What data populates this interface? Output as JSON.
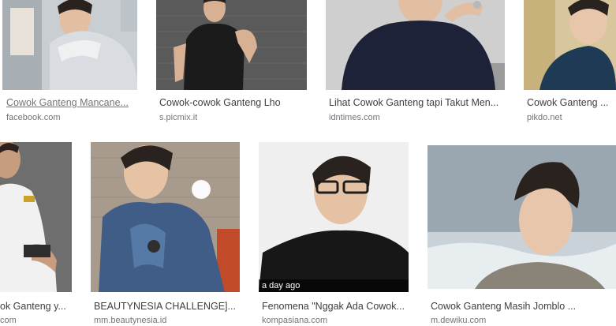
{
  "results": [
    {
      "title": "Cowok Ganteng Mancane...",
      "source": "facebook.com",
      "underline": true
    },
    {
      "title": "Cowok-cowok Ganteng Lho",
      "source": "s.picmix.it"
    },
    {
      "title": "Lihat Cowok Ganteng tapi Takut Men...",
      "source": "idntimes.com"
    },
    {
      "title": "Cowok Ganteng ...",
      "source": "pikdo.net"
    },
    {
      "title": "ok Ganteng y...",
      "source": "com"
    },
    {
      "title": "BEAUTYNESIA CHALLENGE]...",
      "source": "mm.beautynesia.id"
    },
    {
      "title": "Fenomena \"Nggak Ada Cowok...",
      "source": "kompasiana.com",
      "badge": "a day ago"
    },
    {
      "title": "Cowok Ganteng Masih Jomblo ...",
      "source": "m.dewiku.com"
    }
  ],
  "thumb_colors": {
    "bg_street": "#c9ced3",
    "bg_wall": "#5a5a5a",
    "bg_sofa": "#cfcfcf",
    "bg_room": "#d8c79d",
    "bg_studio": "#6e6e6e",
    "bg_brick": "#a89a8c",
    "bg_white": "#efefef",
    "bg_sea": "#9aa7b0",
    "skin": "#e2bfa3",
    "hair": "#2a221e"
  }
}
